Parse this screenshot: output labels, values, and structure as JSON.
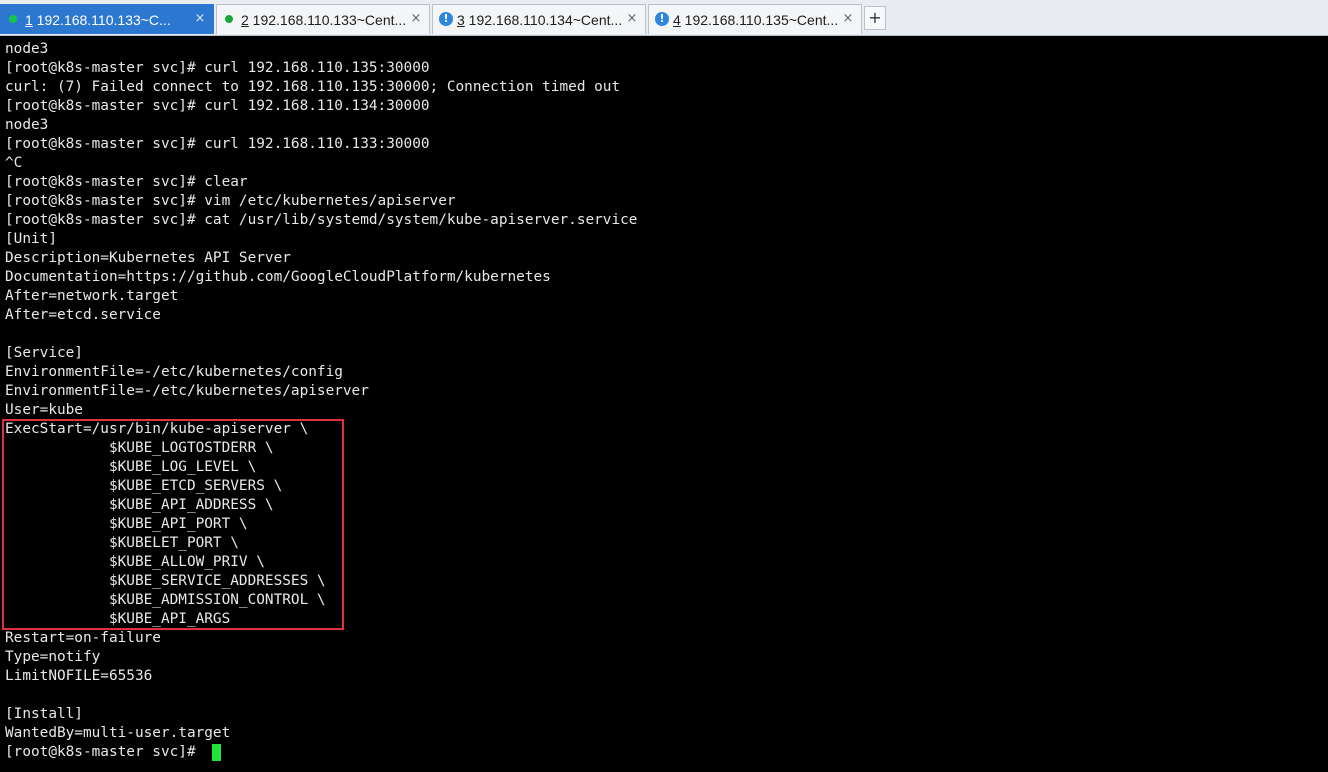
{
  "tabs": [
    {
      "num": "1",
      "title": " 192.168.110.133~C...",
      "status": "ok",
      "close": "×"
    },
    {
      "num": "2",
      "title": " 192.168.110.133~Cent...",
      "status": "ok",
      "close": "×"
    },
    {
      "num": "3",
      "title": " 192.168.110.134~Cent...",
      "status": "warn",
      "close": "×"
    },
    {
      "num": "4",
      "title": " 192.168.110.135~Cent...",
      "status": "warn",
      "close": "×"
    }
  ],
  "add_tab": "+",
  "warn_glyph": "!",
  "terminal": {
    "lines": [
      "node3",
      "[root@k8s-master svc]# curl 192.168.110.135:30000",
      "curl: (7) Failed connect to 192.168.110.135:30000; Connection timed out",
      "[root@k8s-master svc]# curl 192.168.110.134:30000",
      "node3",
      "[root@k8s-master svc]# curl 192.168.110.133:30000",
      "^C",
      "[root@k8s-master svc]# clear",
      "[root@k8s-master svc]# vim /etc/kubernetes/apiserver",
      "[root@k8s-master svc]# cat /usr/lib/systemd/system/kube-apiserver.service",
      "[Unit]",
      "Description=Kubernetes API Server",
      "Documentation=https://github.com/GoogleCloudPlatform/kubernetes",
      "After=network.target",
      "After=etcd.service",
      "",
      "[Service]",
      "EnvironmentFile=-/etc/kubernetes/config",
      "EnvironmentFile=-/etc/kubernetes/apiserver",
      "User=kube",
      "ExecStart=/usr/bin/kube-apiserver \\",
      "            $KUBE_LOGTOSTDERR \\",
      "            $KUBE_LOG_LEVEL \\",
      "            $KUBE_ETCD_SERVERS \\",
      "            $KUBE_API_ADDRESS \\",
      "            $KUBE_API_PORT \\",
      "            $KUBELET_PORT \\",
      "            $KUBE_ALLOW_PRIV \\",
      "            $KUBE_SERVICE_ADDRESSES \\",
      "            $KUBE_ADMISSION_CONTROL \\",
      "            $KUBE_API_ARGS",
      "Restart=on-failure",
      "Type=notify",
      "LimitNOFILE=65536",
      "",
      "[Install]",
      "WantedBy=multi-user.target",
      "[root@k8s-master svc]# "
    ]
  },
  "colors": {
    "background": "#000000",
    "text": "#e8e8e8",
    "cursor": "#1fe43a",
    "highlight_box": "#e0313b",
    "active_tab": "#2c78d0"
  }
}
